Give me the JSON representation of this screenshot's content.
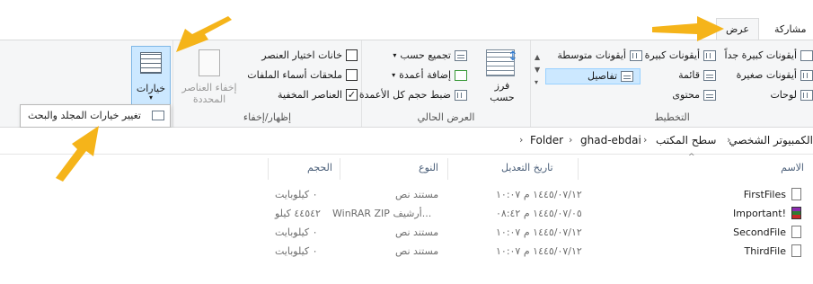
{
  "tabs": {
    "share": "مشاركة",
    "view": "عرض"
  },
  "layout_group": {
    "label": "التخطيط",
    "items": [
      "أيقونات كبيرة جداً",
      "أيقونات كبيرة",
      "أيقونات متوسطة",
      "أيقونات صغيرة",
      "قائمة",
      "تفاصيل",
      "لوحات",
      "محتوى"
    ]
  },
  "current_view_group": {
    "label": "العرض الحالي",
    "sort_by": "فرز\nحسب",
    "group_by": "تجميع حسب",
    "add_columns": "إضافة أعمدة",
    "size_columns": "ضبط حجم كل الأعمدة"
  },
  "show_hide_group": {
    "label": "إظهار/إخفاء",
    "checkboxes": [
      {
        "label": "خانات اختيار العنصر",
        "checked": false
      },
      {
        "label": "ملحقات أسماء الملفات",
        "checked": false
      },
      {
        "label": "العناصر المخفية",
        "checked": true
      }
    ],
    "hide_selected": "إخفاء العناصر\nالمحددة"
  },
  "options": {
    "label": "خيارات",
    "menu_item": "تغيير خيارات المجلد والبحث"
  },
  "breadcrumb": [
    "الكمبيوتر الشخصي",
    "سطح المكتب",
    "ghad-ebdai",
    "Folder"
  ],
  "columns": {
    "name": "الاسم",
    "date": "تاريخ التعديل",
    "type": "النوع",
    "size": "الحجم"
  },
  "files": [
    {
      "name": "FirstFiles",
      "date": "١٤٤٥/٠٧/١٢ م ١٠:٠٧",
      "type": "مستند نص",
      "size": "٠ كيلوبايت",
      "icon": "text-file-icon"
    },
    {
      "name": "Important!",
      "date": "١٤٤٥/٠٧/٠٥ م ٠٨:٤٢",
      "type": "WinRAR ZIP أرشيف...",
      "size": "٤٤٥٤٢ كيلو",
      "icon": "rar-archive-icon"
    },
    {
      "name": "SecondFile",
      "date": "١٤٤٥/٠٧/١٢ م ١٠:٠٧",
      "type": "مستند نص",
      "size": "٠ كيلوبايت",
      "icon": "text-file-icon"
    },
    {
      "name": "ThirdFile",
      "date": "١٤٤٥/٠٧/١٢ م ١٠:٠٧",
      "type": "مستند نص",
      "size": "٠ كيلوبايت",
      "icon": "text-file-icon"
    }
  ],
  "colors": {
    "accent_arrow": "#f5b41a",
    "selection": "#cce8ff",
    "ribbon_bg": "#f5f6f7"
  }
}
